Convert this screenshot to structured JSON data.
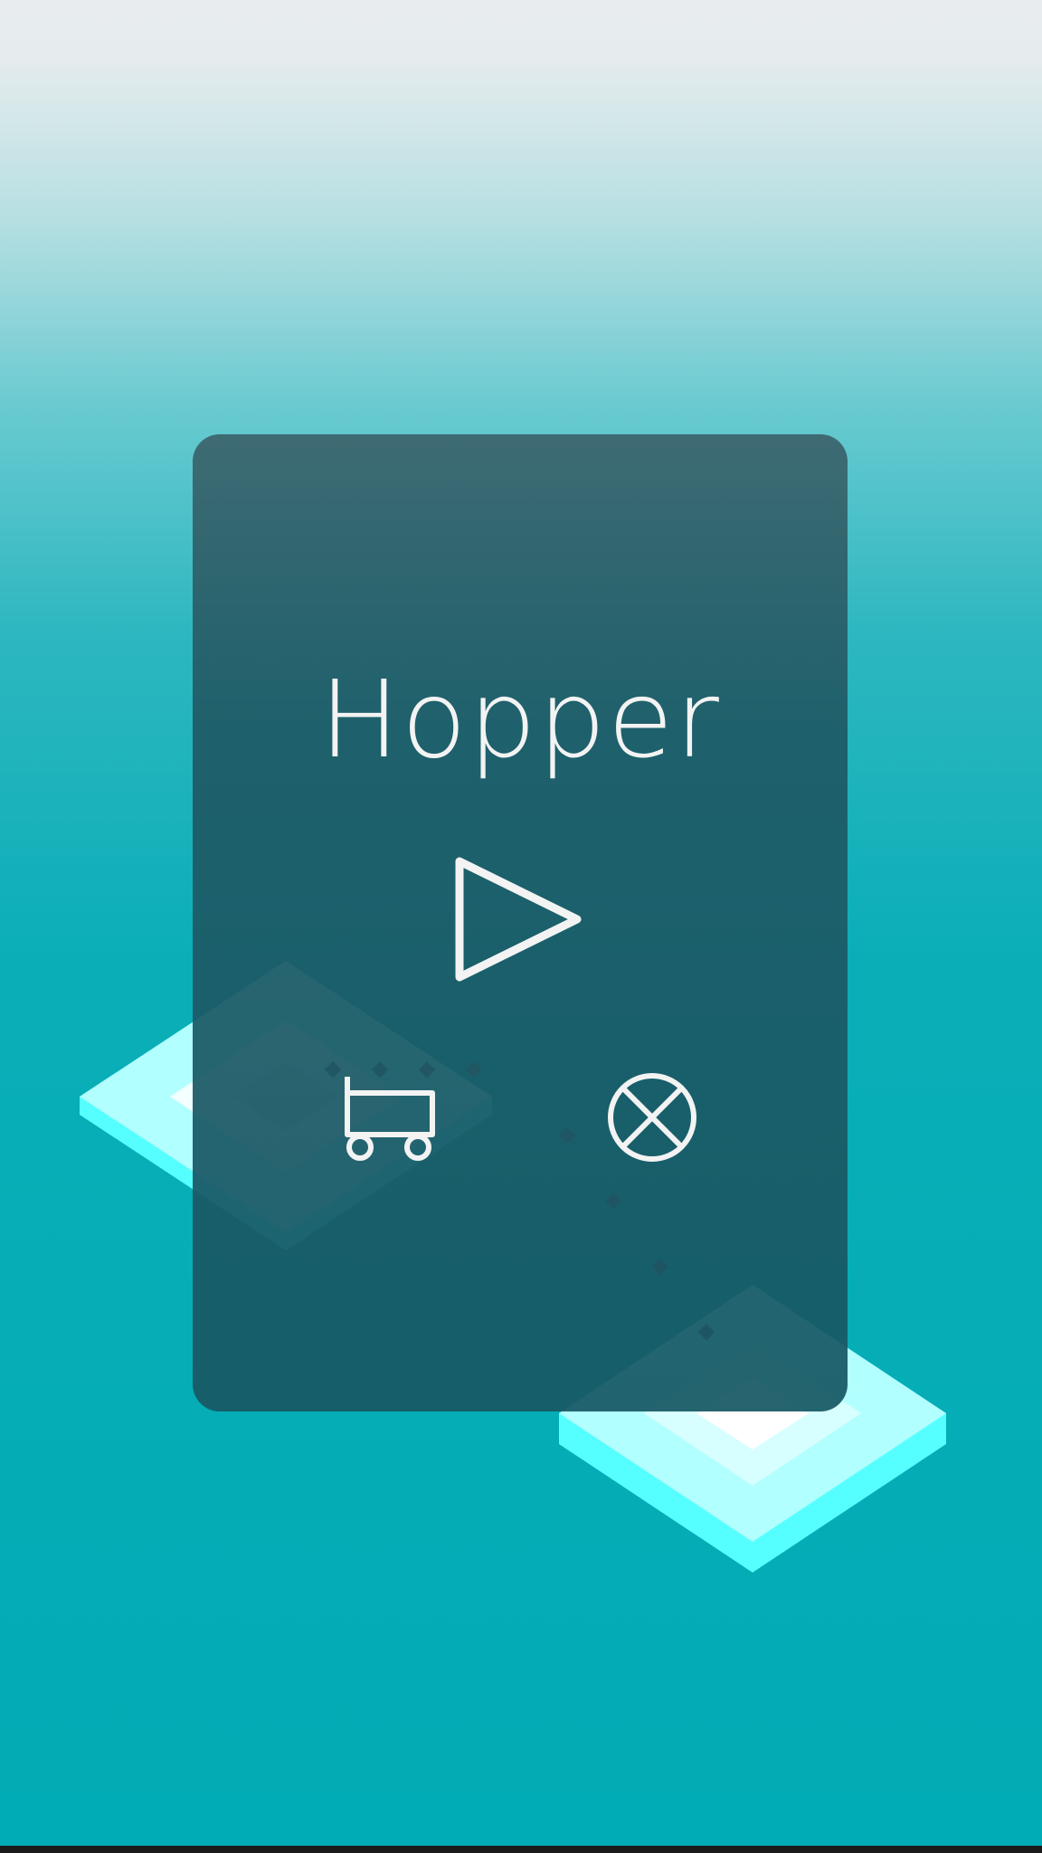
{
  "game": {
    "title": "Hopper"
  },
  "menu": {
    "buttons": [
      {
        "id": "play",
        "icon": "play-triangle-icon"
      },
      {
        "id": "shop",
        "icon": "cart-icon"
      },
      {
        "id": "quit",
        "icon": "close-circle-icon"
      }
    ]
  },
  "colors": {
    "sky_top": "#e8ecee",
    "sea": "#00acb5",
    "panel": "#1e5a66",
    "platform_top": "#b2ffff",
    "platform_side": "#56ffff",
    "trail_dot": "#7a2a48",
    "icon_stroke": "#f3f3f3"
  }
}
